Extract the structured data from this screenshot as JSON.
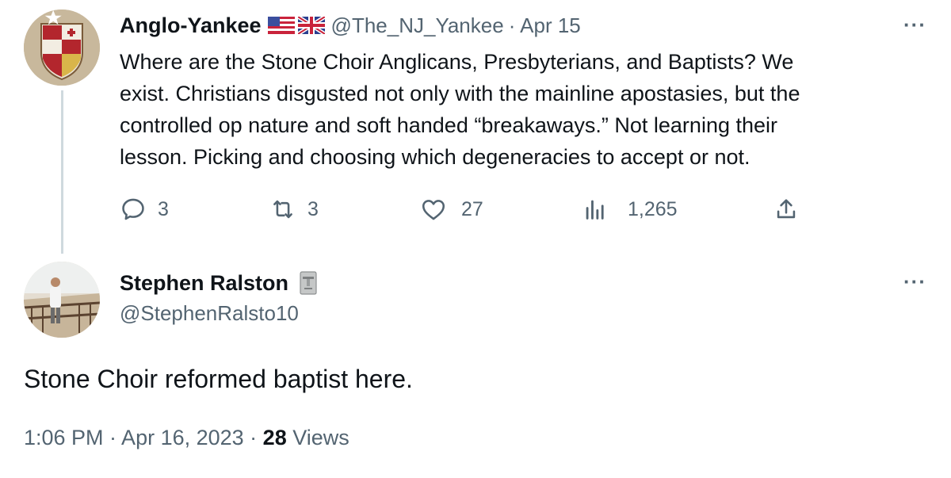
{
  "parent_tweet": {
    "display_name": "Anglo-Yankee",
    "flags": [
      "us-flag-icon",
      "uk-flag-icon"
    ],
    "handle": "@The_NJ_Yankee",
    "date": "· Apr 15",
    "more": "···",
    "text_lines": [
      "Where are the Stone Choir Anglicans, Presbyterians, and Baptists? We",
      "exist. Christians disgusted not only with the mainline apostasies, but the",
      "controlled op nature and soft handed “breakaways.” Not learning their",
      "lesson. Picking and choosing which degeneracies to accept or not."
    ],
    "actions": {
      "replies": "3",
      "retweets": "3",
      "likes": "27",
      "views": "1,265"
    }
  },
  "reply_tweet": {
    "display_name": "Stephen Ralston",
    "badge_icon": "moai-icon",
    "handle": "@StephenRalsto10",
    "more": "···",
    "text": "Stone Choir reformed baptist here.",
    "time": "1:06 PM · Apr 16, 2023 · ",
    "views_count": "28",
    "views_label": " Views"
  },
  "colors": {
    "text": "#0f1419",
    "secondary": "#536471",
    "thread_line": "#cfd9de"
  }
}
